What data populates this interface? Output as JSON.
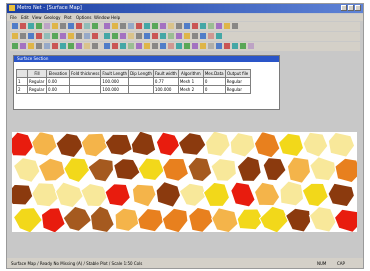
{
  "window": {
    "title": "Metro Net - [Surface Map]"
  },
  "menu": [
    "File",
    "Edit",
    "View",
    "Geology",
    "Plot",
    "Options",
    "Window",
    "Help"
  ],
  "panel": {
    "title": "Surface Section",
    "columns": [
      "",
      "Fill",
      "Elevation",
      "Fold thickness",
      "Fault Length",
      "Dip Length",
      "Fault width",
      "Algorithm",
      "Mes.Data",
      "Output file"
    ],
    "rows": [
      [
        "1",
        "Regular",
        "0.00",
        "",
        "100.000",
        "",
        "0.77",
        "Mesh 1",
        "0",
        "Regular"
      ],
      [
        "2",
        "Regular",
        "0.00",
        "",
        "100.000",
        "",
        "100.000",
        "Mesh 2",
        "0",
        "Regular"
      ]
    ]
  },
  "status": {
    "left": "Surface Map / Ready  No Missing (A) / Stable Plot / Scale 1:50 Cols",
    "right1": "NUM",
    "right2": "CAP"
  },
  "colors": {
    "dark_brown": "#8b3a0e",
    "orange": "#e8801e",
    "light_orange": "#f4b44a",
    "pale_yellow": "#f8e89a",
    "yellow": "#f2d81a",
    "red": "#e81c0e",
    "brown": "#a55a1f",
    "background": "#c8c8c8"
  }
}
